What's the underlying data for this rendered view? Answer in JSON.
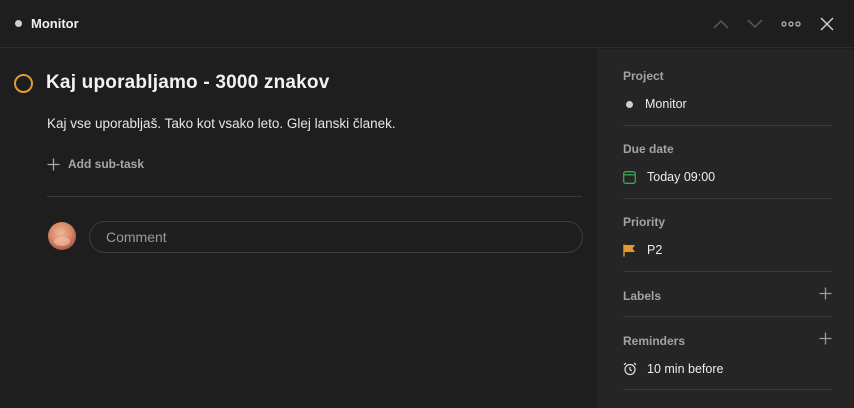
{
  "header": {
    "project_name": "Monitor"
  },
  "task": {
    "title": "Kaj uporabljamo - 3000 znakov",
    "description": "Kaj vse uporabljaš. Tako kot vsako leto. Glej lanski članek.",
    "add_subtask_label": "Add sub-task"
  },
  "comment": {
    "placeholder": "Comment"
  },
  "sidebar": {
    "project": {
      "label": "Project",
      "value": "Monitor"
    },
    "due_date": {
      "label": "Due date",
      "value": "Today 09:00",
      "color": "#3aa657"
    },
    "priority": {
      "label": "Priority",
      "value": "P2",
      "color": "#e59a2f"
    },
    "labels": {
      "label": "Labels"
    },
    "reminders": {
      "label": "Reminders",
      "value": "10 min before"
    }
  },
  "icons": {
    "header": [
      "chevron-up-icon",
      "chevron-down-icon",
      "more-icon",
      "close-icon"
    ],
    "sidebar": [
      "project-dot-icon",
      "calendar-icon",
      "flag-icon",
      "plus-icon",
      "alarm-icon"
    ]
  }
}
